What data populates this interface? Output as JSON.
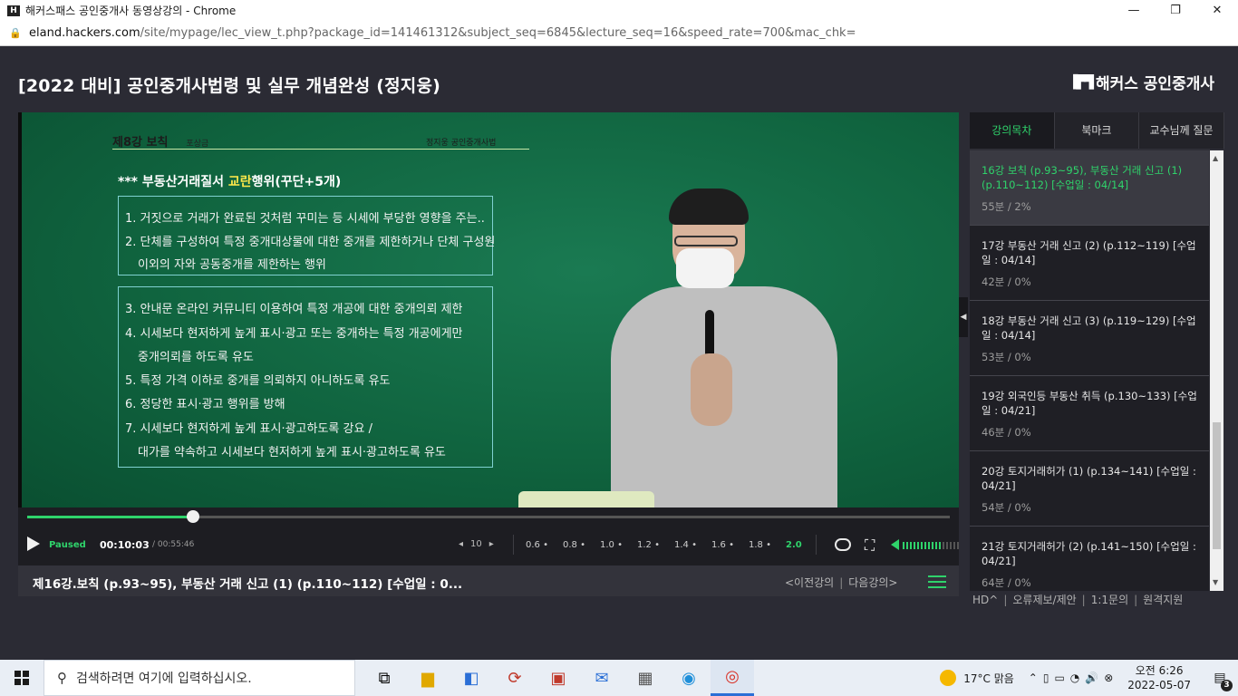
{
  "window": {
    "title": "해커스패스 공인중개사 동영상강의 - Chrome",
    "url_host": "eland.hackers.com",
    "url_path": "/site/mypage/lec_view_t.php?package_id=141461312&subject_seq=6845&lecture_seq=16&speed_rate=700&mac_chk="
  },
  "page": {
    "course_title": "[2022 대비] 공인중개사법령 및 실무 개념완성 (정지웅)",
    "brand": "해커스 공인중개사"
  },
  "slide": {
    "header": "제8강 보칙",
    "header_sub": "포상금",
    "brand": "정지웅 공인중개사법",
    "heading_pre": "*** 부동산거래질서 ",
    "heading_hl": "교란",
    "heading_post": "행위(꾸단+5개)",
    "lines": [
      "1. 거짓으로 거래가 완료된 것처럼 꾸미는 등 시세에 부당한 영향을 주는..",
      "2. 단체를 구성하여 특정 중개대상물에 대한 중개를 제한하거나 단체 구성원",
      "이외의 자와 공동중개를 제한하는 행위",
      "3. 안내문 온라인 커뮤니티 이용하여 특정 개공에 대한 중개의뢰 제한",
      "4. 시세보다 현저하게 높게 표시·광고 또는 중개하는 특정 개공에게만",
      "중개의뢰를 하도록 유도",
      "5. 특정 가격 이하로 중개를 의뢰하지 아니하도록 유도",
      "6. 정당한 표시·광고 행위를 방해",
      "7. 시세보다 현저하게 높게 표시·광고하도록 강요 /",
      "대가를 약속하고 시세보다 현저하게 높게 표시·광고하도록 유도"
    ]
  },
  "player": {
    "state": "Paused",
    "current_time": "00:10:03",
    "total_time": "/ 00:55:46",
    "progress": 0.18,
    "skip_seconds": "10",
    "speeds": [
      "0.6",
      "0.8",
      "1.0",
      "1.2",
      "1.4",
      "1.6",
      "1.8",
      "2.0"
    ],
    "active_speed": "2.0",
    "volume_level": 0.7
  },
  "subbar": {
    "now_playing": "제16강.보칙 (p.93~95), 부동산 거래 신고 (1) (p.110~112) [수업일 : 0...",
    "prev": "<이전강의",
    "next": "다음강의>"
  },
  "panel": {
    "tabs": [
      "강의목차",
      "북마크",
      "교수님께 질문"
    ],
    "lectures": [
      {
        "title": "16강 보칙 (p.93~95), 부동산 거래 신고 (1) (p.110~112) [수업일 : 04/14]",
        "meta": "55분 / 2%"
      },
      {
        "title": "17강 부동산 거래 신고 (2) (p.112~119) [수업일 : 04/14]",
        "meta": "42분 / 0%"
      },
      {
        "title": "18강 부동산 거래 신고 (3) (p.119~129) [수업일 : 04/14]",
        "meta": "53분 / 0%"
      },
      {
        "title": "19강 외국인등 부동산 취득 (p.130~133) [수업일 : 04/21]",
        "meta": "46분 / 0%"
      },
      {
        "title": "20강 토지거래허가 (1) (p.134~141) [수업일 : 04/21]",
        "meta": "54분 / 0%"
      },
      {
        "title": "21강 토지거래허가 (2) (p.141~150) [수업일 : 04/21]",
        "meta": "64분 / 0%"
      }
    ],
    "links": [
      "HD^",
      "오류제보/제안",
      "1:1문의",
      "원격지원"
    ]
  },
  "taskbar": {
    "search_placeholder": "검색하려면 여기에 입력하십시오.",
    "weather": "17°C 맑음",
    "time": "오전 6:26",
    "date": "2022-05-07",
    "notifications": "3"
  },
  "colors": {
    "accent": "#2fd36b",
    "board": "#10643f"
  }
}
